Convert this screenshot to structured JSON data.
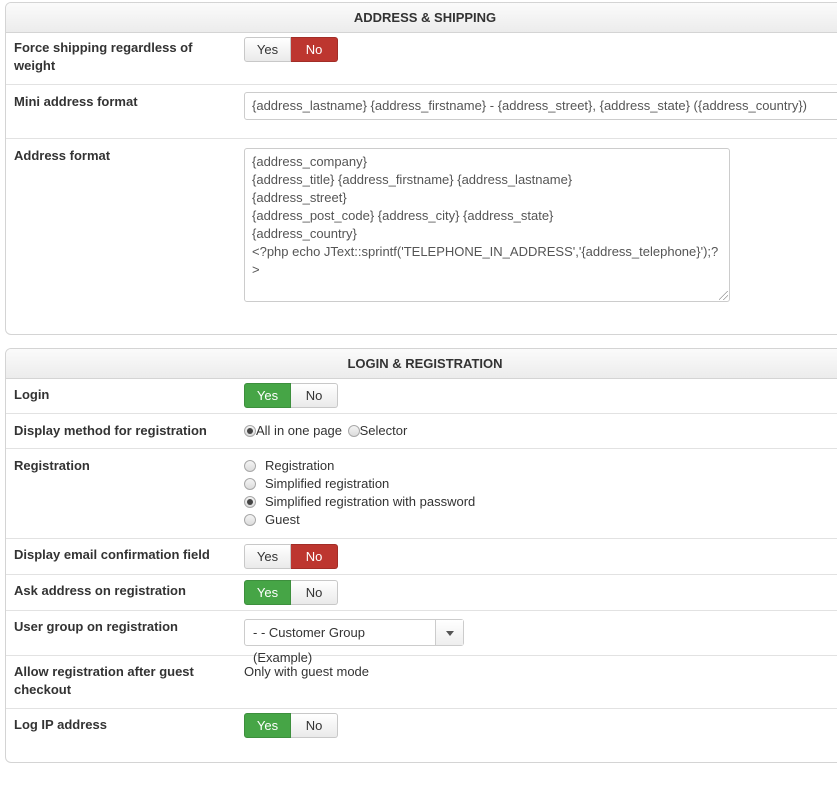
{
  "address_shipping": {
    "title": "ADDRESS & SHIPPING",
    "force_shipping": {
      "label": "Force shipping regardless of weight",
      "yes": "Yes",
      "no": "No",
      "value": "No"
    },
    "mini_address": {
      "label": "Mini address format",
      "value": "{address_lastname} {address_firstname} - {address_street}, {address_state} ({address_country})"
    },
    "address_format": {
      "label": "Address format",
      "lines": [
        "{address_company}",
        "{address_title} {address_firstname} {address_lastname}",
        "{address_street}",
        "{address_post_code} {address_city} {address_state}",
        "{address_country}",
        "<?php echo JText::sprintf('TELEPHONE_IN_ADDRESS','{address_telephone}');?",
        ">"
      ]
    }
  },
  "login_registration": {
    "title": "LOGIN & REGISTRATION",
    "login": {
      "label": "Login",
      "yes": "Yes",
      "no": "No",
      "value": "Yes"
    },
    "display_method": {
      "label": "Display method for registration",
      "options": [
        "All in one page",
        "Selector"
      ],
      "selected": "All in one page"
    },
    "registration": {
      "label": "Registration",
      "options": [
        "Registration",
        "Simplified registration",
        "Simplified registration with password",
        "Guest"
      ],
      "selected": "Simplified registration with password"
    },
    "email_confirmation": {
      "label": "Display email confirmation field",
      "yes": "Yes",
      "no": "No",
      "value": "No"
    },
    "ask_address": {
      "label": "Ask address on registration",
      "yes": "Yes",
      "no": "No",
      "value": "Yes"
    },
    "user_group": {
      "label": "User group on registration",
      "value": "- - Customer Group (Example)"
    },
    "allow_after_guest": {
      "label": "Allow registration after guest checkout",
      "value": "Only with guest mode"
    },
    "log_ip": {
      "label": "Log IP address",
      "yes": "Yes",
      "no": "No",
      "value": "Yes"
    }
  },
  "colors": {
    "yes_active": "#46a546",
    "no_active": "#bd362f"
  }
}
